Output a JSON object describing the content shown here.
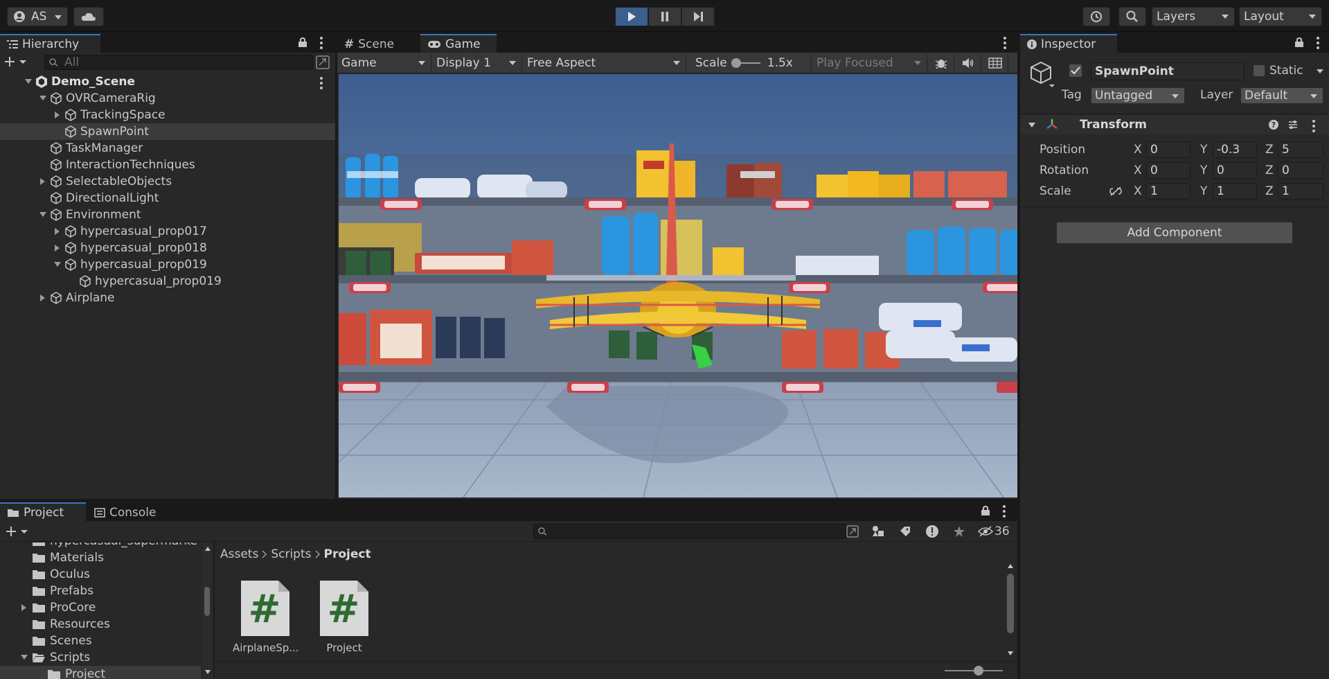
{
  "toolbar": {
    "account_label": "AS",
    "layers_label": "Layers",
    "layout_label": "Layout"
  },
  "hierarchy": {
    "tab_label": "Hierarchy",
    "search_placeholder": "All",
    "items": [
      {
        "label": "Demo_Scene"
      },
      {
        "label": "OVRCameraRig"
      },
      {
        "label": "TrackingSpace"
      },
      {
        "label": "SpawnPoint"
      },
      {
        "label": "TaskManager"
      },
      {
        "label": "InteractionTechniques"
      },
      {
        "label": "SelectableObjects"
      },
      {
        "label": "DirectionalLight"
      },
      {
        "label": "Environment"
      },
      {
        "label": "hypercasual_prop017"
      },
      {
        "label": "hypercasual_prop018"
      },
      {
        "label": "hypercasual_prop019"
      },
      {
        "label": "hypercasual_prop019"
      },
      {
        "label": "Airplane"
      }
    ]
  },
  "gameview": {
    "tabs": [
      {
        "label": "Scene"
      },
      {
        "label": "Game"
      }
    ],
    "mode_dropdown": "Game",
    "display_dropdown": "Display 1",
    "aspect_dropdown": "Free Aspect",
    "scale_label": "Scale",
    "scale_value": "1.5x",
    "play_focused": "Play Focused"
  },
  "inspector": {
    "tab_label": "Inspector",
    "object_name": "SpawnPoint",
    "static_label": "Static",
    "tag_label": "Tag",
    "tag_value": "Untagged",
    "layer_label": "Layer",
    "layer_value": "Default",
    "component_title": "Transform",
    "position_label": "Position",
    "rotation_label": "Rotation",
    "scale_label": "Scale",
    "axis_x": "X",
    "axis_y": "Y",
    "axis_z": "Z",
    "position": {
      "x": "0",
      "y": "-0.3",
      "z": "5"
    },
    "rotation": {
      "x": "0",
      "y": "0",
      "z": "0"
    },
    "scale": {
      "x": "1",
      "y": "1",
      "z": "1"
    },
    "add_component": "Add Component"
  },
  "project": {
    "tabs": [
      {
        "label": "Project"
      },
      {
        "label": "Console"
      }
    ],
    "hidden_count": "36",
    "breadcrumb": [
      "Assets",
      "Scripts",
      "Project"
    ],
    "tree": [
      {
        "label": "hypercasual_supermarke"
      },
      {
        "label": "Materials"
      },
      {
        "label": "Oculus"
      },
      {
        "label": "Prefabs"
      },
      {
        "label": "ProCore"
      },
      {
        "label": "Resources"
      },
      {
        "label": "Scenes"
      },
      {
        "label": "Scripts"
      },
      {
        "label": "Project"
      }
    ],
    "assets": [
      {
        "label": "AirplaneSp..."
      },
      {
        "label": "Project"
      }
    ]
  },
  "colors": {
    "accent": "#3a79bb",
    "panel": "#282828",
    "toolbar": "#191919",
    "script_hash": "#2f6a32"
  }
}
